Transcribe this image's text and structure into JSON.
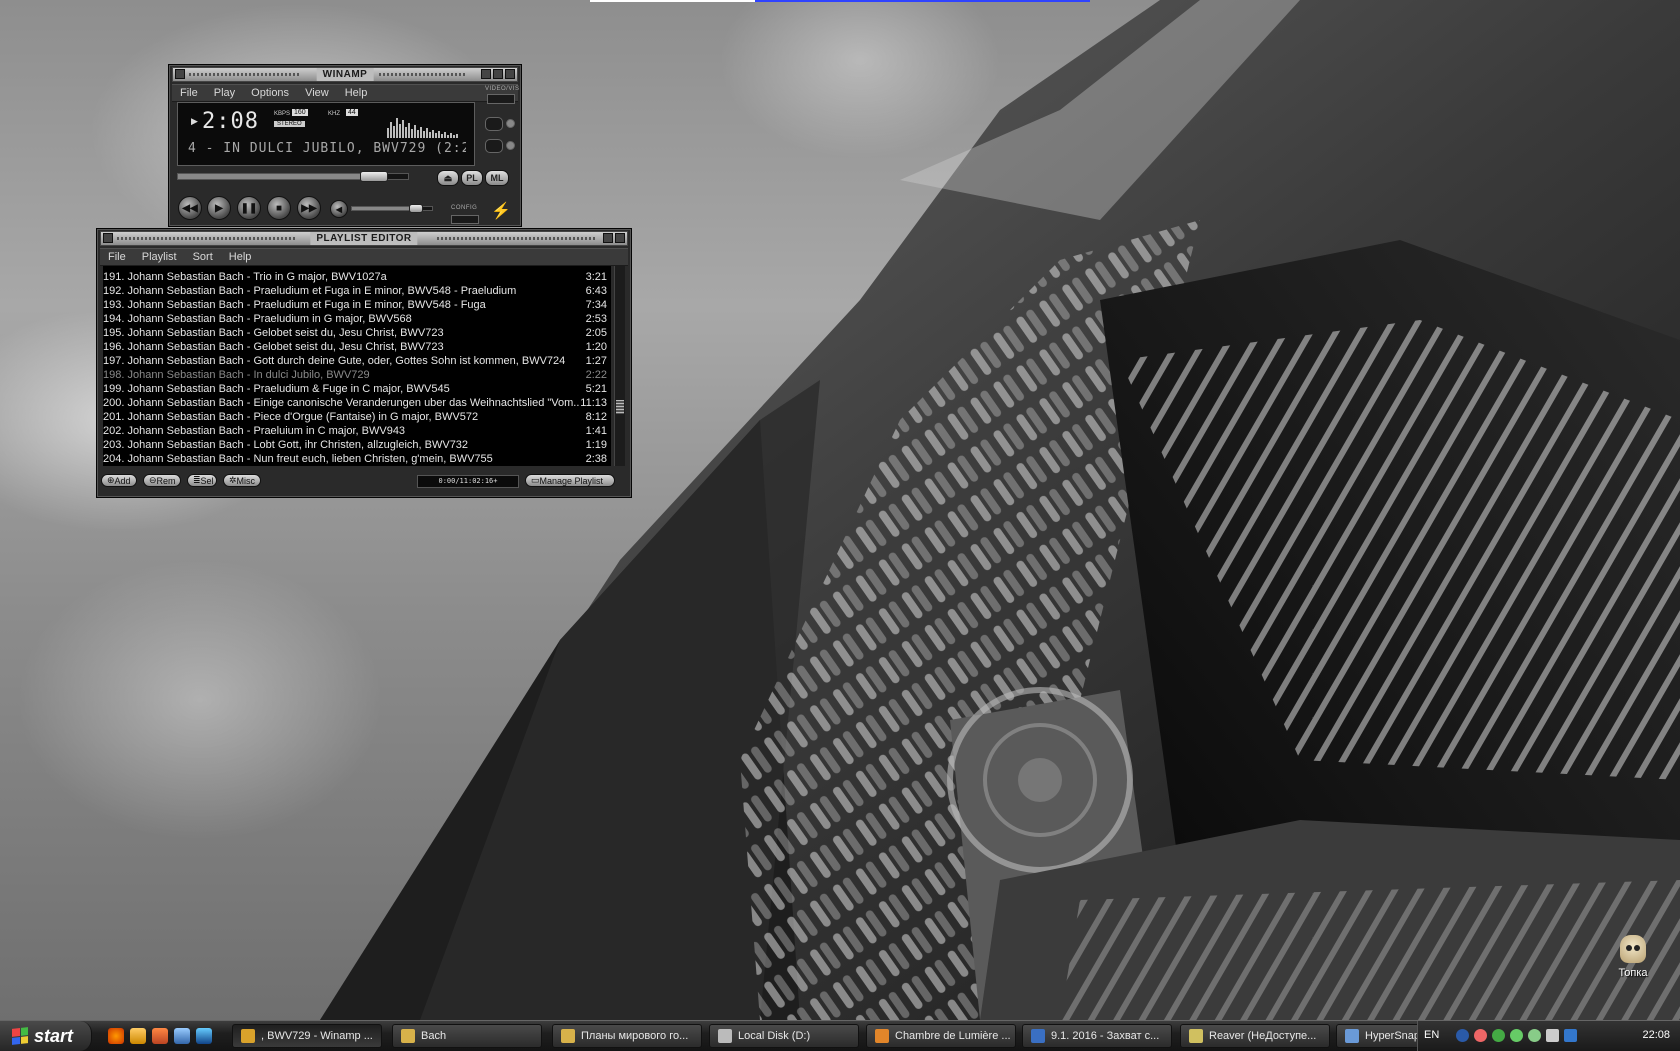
{
  "winamp": {
    "title": "WINAMP",
    "menu": [
      "File",
      "Play",
      "Options",
      "View",
      "Help"
    ],
    "time": "2:08",
    "kbps_label": "KBPS",
    "kbps": "160",
    "khz_label": "KHZ",
    "khz": "44",
    "stereo": "STEREO",
    "ticker": "4 - IN DULCI JUBILO, BWV729 (2:2",
    "video_vis_label": "VIDEO/VIS",
    "config_label": "CONFIG",
    "pl_label": "PL",
    "ml_label": "ML",
    "seek_progress": 0.85,
    "volume_progress": 0.8
  },
  "playlist": {
    "title": "PLAYLIST EDITOR",
    "menu": [
      "File",
      "Playlist",
      "Sort",
      "Help"
    ],
    "items": [
      {
        "title": "191. Johann Sebastian Bach - Trio in G major, BWV1027a",
        "duration": "3:21"
      },
      {
        "title": "192. Johann Sebastian Bach - Praeludium et Fuga in E minor, BWV548 - Praeludium",
        "duration": "6:43"
      },
      {
        "title": "193. Johann Sebastian Bach - Praeludium et Fuga in E minor, BWV548 - Fuga",
        "duration": "7:34"
      },
      {
        "title": "194. Johann Sebastian Bach - Praeludium in G major, BWV568",
        "duration": "2:53"
      },
      {
        "title": "195. Johann Sebastian Bach - Gelobet seist du, Jesu Christ, BWV723",
        "duration": "2:05"
      },
      {
        "title": "196. Johann Sebastian Bach - Gelobet seist du, Jesu Christ, BWV723",
        "duration": "1:20"
      },
      {
        "title": "197. Johann Sebastian Bach - Gott durch deine Gute, oder, Gottes Sohn ist kommen, BWV724",
        "duration": "1:27"
      },
      {
        "title": "198. Johann Sebastian Bach - In dulci Jubilo, BWV729",
        "duration": "2:22"
      },
      {
        "title": "199. Johann Sebastian Bach - Praeludium & Fuge in C major, BWV545",
        "duration": "5:21"
      },
      {
        "title": "200. Johann Sebastian Bach - Einige canonische Veranderungen uber das Weihnachtslied \"Vom...",
        "duration": "11:13"
      },
      {
        "title": "201. Johann Sebastian Bach - Piece d'Orgue (Fantaise) in G major, BWV572",
        "duration": "8:12"
      },
      {
        "title": "202. Johann Sebastian Bach - Praeluium in C major, BWV943",
        "duration": "1:41"
      },
      {
        "title": "203. Johann Sebastian Bach - Lobt Gott, ihr Christen, allzugleich, BWV732",
        "duration": "1:19"
      },
      {
        "title": "204. Johann Sebastian Bach - Nun freut euch, lieben Christen, g'mein, BWV755",
        "duration": "2:38"
      }
    ],
    "current_index": 7,
    "buttons": {
      "add": "Add",
      "rem": "Rem",
      "sel": "Sel",
      "misc": "Misc",
      "manage": "Manage Playlist"
    },
    "time_display": "0:00/11:02:16+"
  },
  "desktop_icon": {
    "label": "Топка"
  },
  "taskbar": {
    "start": "start",
    "tasks": [
      {
        "label": ", BWV729 - Winamp ...",
        "active": true
      },
      {
        "label": "Bach",
        "active": false
      },
      {
        "label": "Планы мирового го...",
        "active": false
      },
      {
        "label": "Local Disk (D:)",
        "active": false
      },
      {
        "label": "Chambre de Lumière ...",
        "active": false
      },
      {
        "label": "9.1. 2016 - Захват с...",
        "active": false
      },
      {
        "label": "Reaver (НеДоступе...",
        "active": false
      },
      {
        "label": "HyperSnap 6",
        "active": false
      }
    ],
    "lang": "EN",
    "clock": "22:08"
  }
}
